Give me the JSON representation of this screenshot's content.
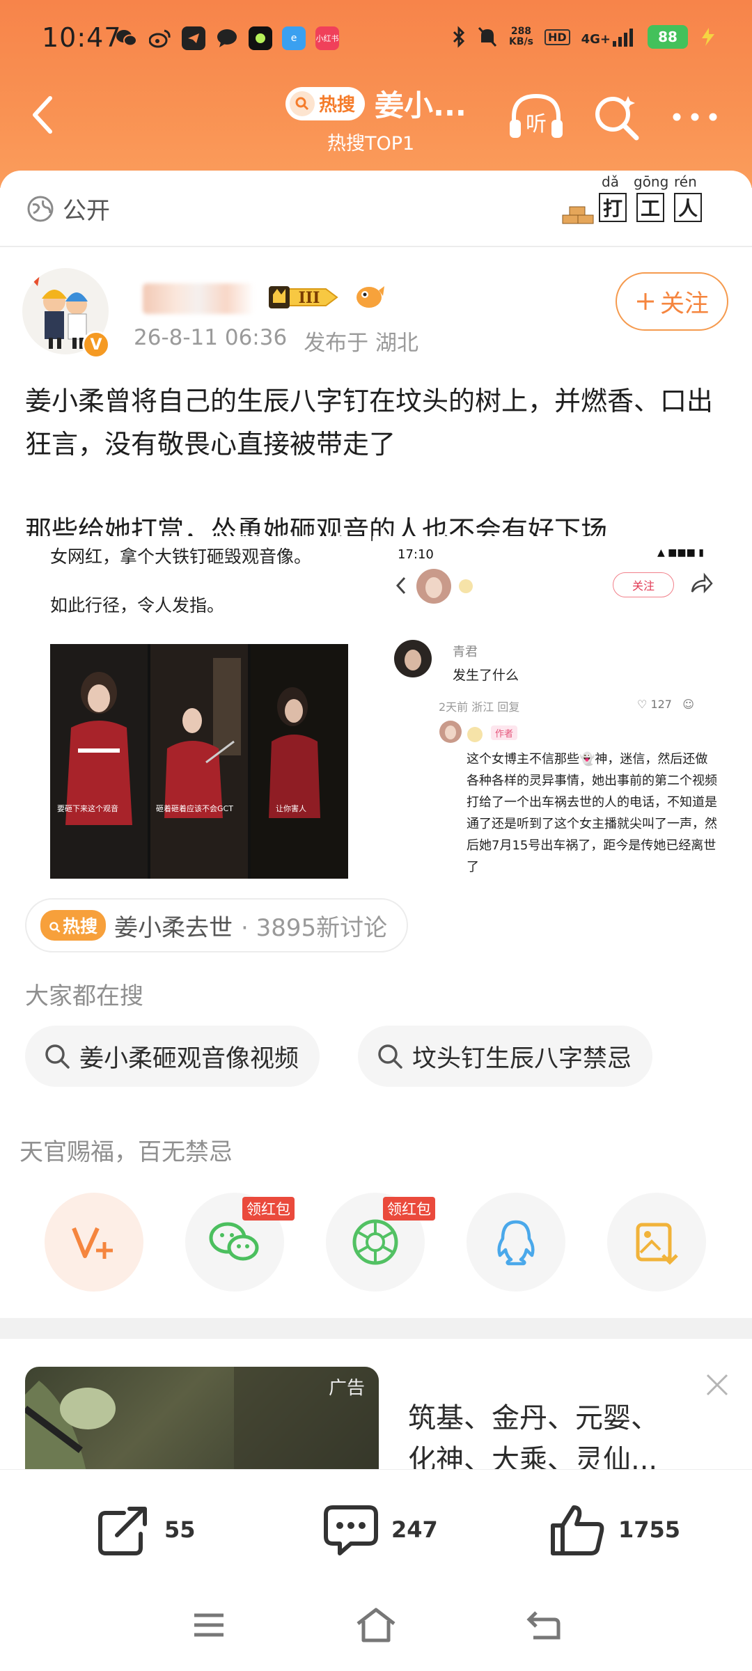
{
  "status_bar": {
    "time": "10:47",
    "net_speed_value": "288",
    "net_speed_unit": "KB/s",
    "hd": "HD",
    "signal": "4G+",
    "battery": "88"
  },
  "nav": {
    "hot_badge": "热搜",
    "title": "姜小...",
    "subtitle": "热搜TOP1"
  },
  "post": {
    "visibility": "公开",
    "sticker": {
      "pinyin": [
        "dǎ",
        "gōng",
        "rén"
      ],
      "chars": [
        "打",
        "工",
        "人"
      ]
    },
    "level_badge": "III",
    "verified_mark": "V",
    "date": "26-8-11 06:36",
    "location": "发布于 湖北",
    "follow_label": "关注",
    "paragraphs": [
      "姜小柔曾将自己的生辰八字钉在坟头的树上，并燃香、口出狂言，没有敬畏心直接被带走了",
      "那些给她打赏，怂恿她砸观音的人也不会有好下场"
    ],
    "images": {
      "left_caption_1": "女网红，拿个大铁钉砸毁观音像。",
      "left_caption_2": "如此行径，令人发指。",
      "frame_captions": [
        "要砸下来这个观音",
        "砸着砸着应该不会GCT",
        "让你害人"
      ],
      "right_time": "17:10",
      "right_follow": "关注",
      "right_commenter": "青君",
      "right_comment": "发生了什么",
      "right_comment_meta": "2天前 浙江 回复",
      "right_comment_likes": "127",
      "right_author_tag": "作者",
      "right_reply": "这个女博主不信那些👻神，迷信，然后还做各种各样的灵异事情，她出事前的第二个视频打给了一个出车祸去世的人的电话，不知道是通了还是听到了这个女主播就尖叫了一声，然后她7月15号出车祸了，距今是传她已经离世了"
    }
  },
  "topic": {
    "tag": "热搜",
    "name": "姜小柔去世",
    "discussions": "· 3895新讨论"
  },
  "search": {
    "heading": "大家都在搜",
    "chips": [
      "姜小柔砸观音像视频",
      "坟头钉生辰八字禁忌"
    ]
  },
  "share": {
    "blessing": "天官赐福，百无禁忌",
    "redpack_label": "领红包",
    "items": [
      "v-plus-icon",
      "wechat-icon",
      "moments-icon",
      "qq-icon",
      "save-image-icon"
    ]
  },
  "ad": {
    "tag": "广告",
    "text_line1": "筑基、金丹、元婴、",
    "text_line2": "化神、大乘、灵仙..."
  },
  "actions": {
    "share_count": "55",
    "comment_count": "247",
    "like_count": "1755"
  },
  "colors": {
    "brand_orange": "#f7844a",
    "accent_orange": "#f5853e",
    "hot_tag": "#f7a03b",
    "redpack": "#ea4a3c"
  }
}
